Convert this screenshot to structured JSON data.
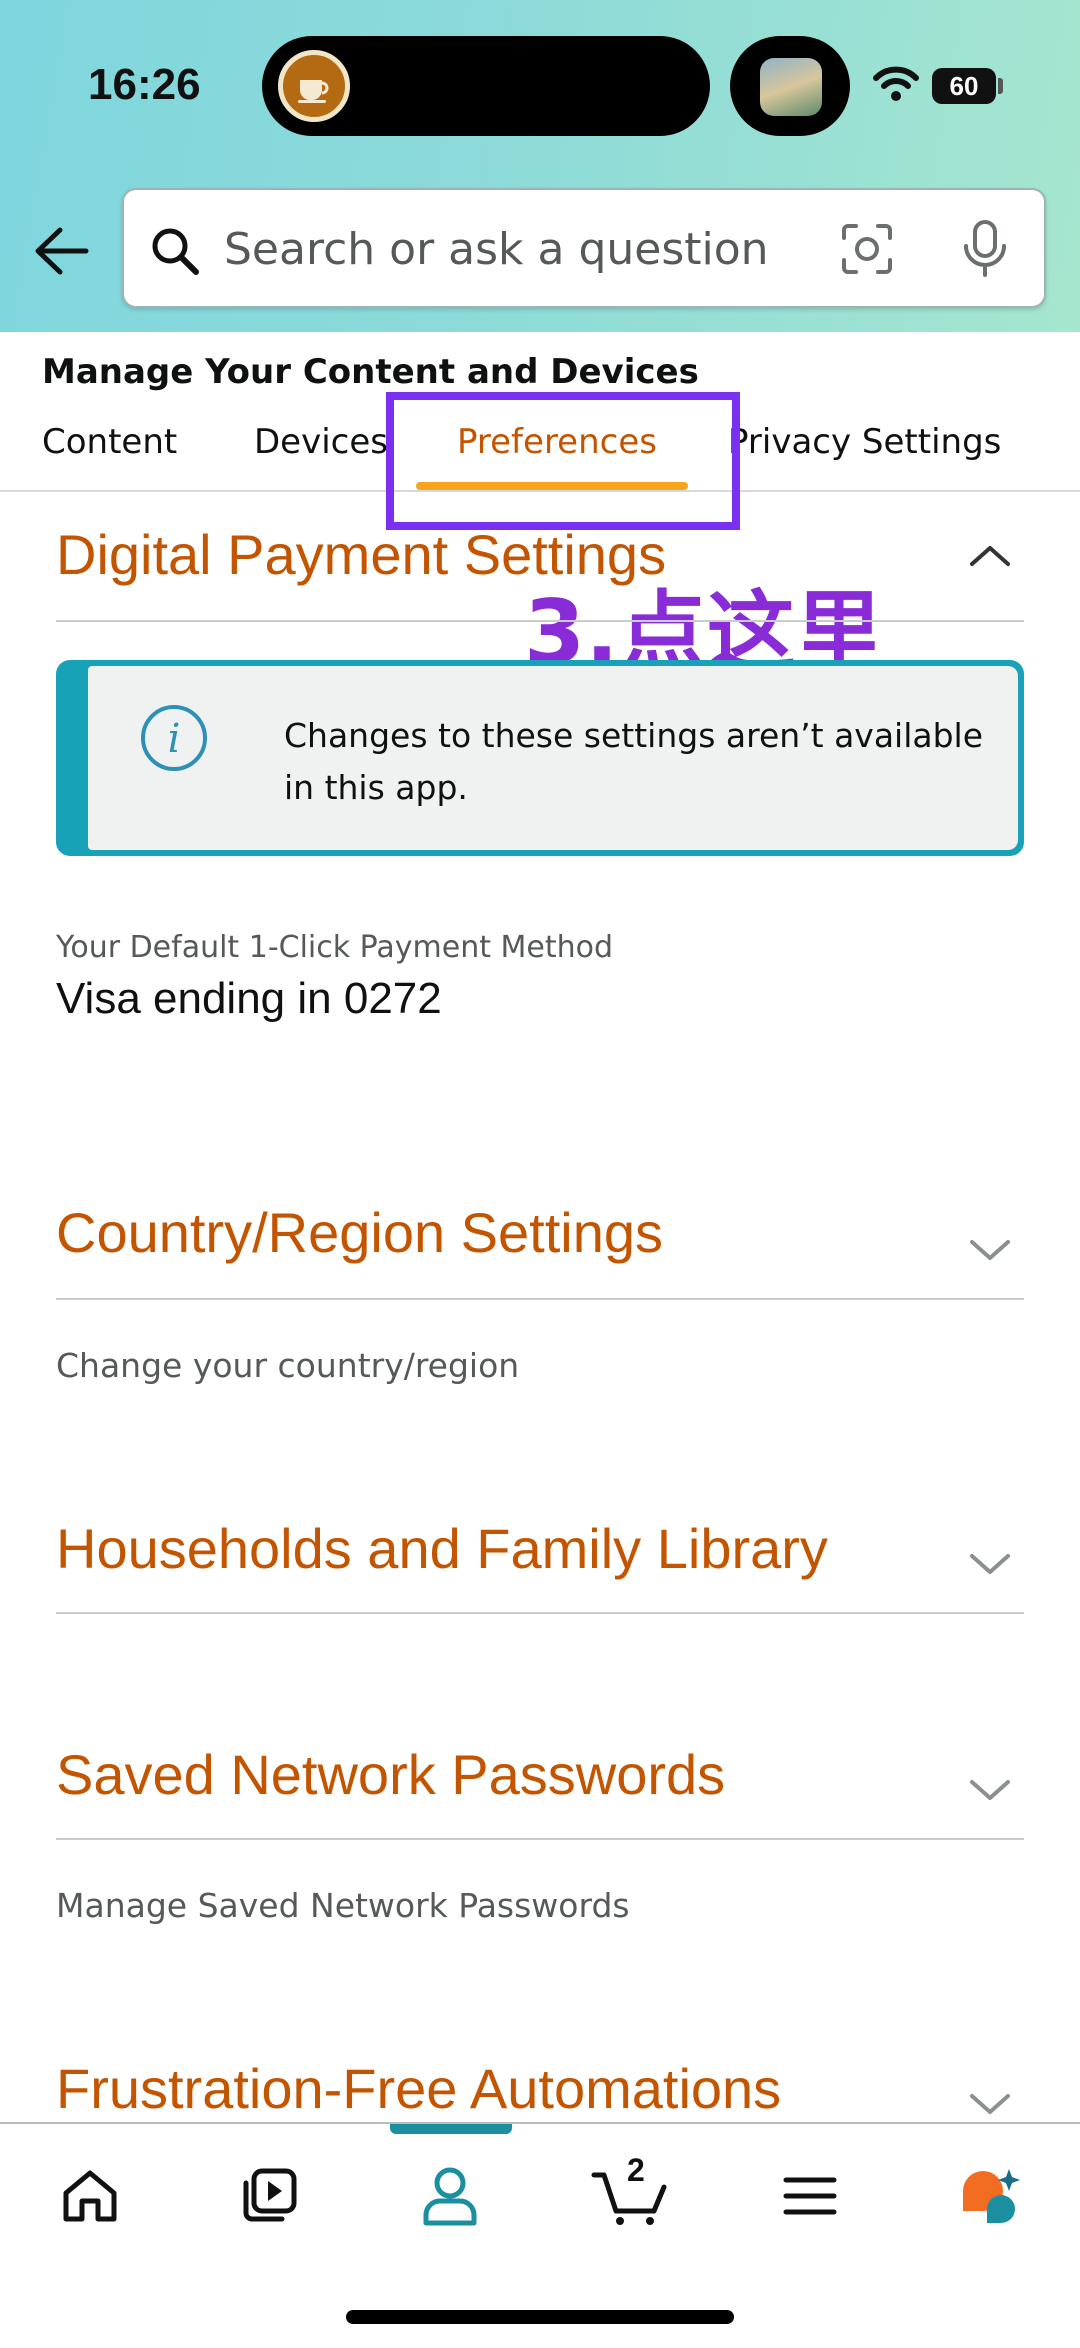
{
  "status_bar": {
    "time": "16:26",
    "battery": "60"
  },
  "search": {
    "placeholder": "Search or ask a question"
  },
  "page": {
    "title": "Manage Your Content and Devices",
    "tabs": [
      {
        "label": "Content",
        "active": false
      },
      {
        "label": "Devices",
        "active": false
      },
      {
        "label": "Preferences",
        "active": true
      },
      {
        "label": "Privacy Settings",
        "active": false
      }
    ]
  },
  "annotation": {
    "text": "3.点这里",
    "color": "#8a2bd8",
    "box_color": "#7b2ff0"
  },
  "sections": {
    "digital_payment": {
      "title": "Digital Payment Settings",
      "expanded": true,
      "alert_text": "Changes to these settings aren’t available in this app.",
      "payment_label": "Your Default 1-Click Payment Method",
      "payment_value": "Visa ending in 0272"
    },
    "country_region": {
      "title": "Country/Region Settings",
      "subtitle": "Change your country/region"
    },
    "households": {
      "title": "Households and Family Library"
    },
    "saved_passwords": {
      "title": "Saved Network Passwords",
      "subtitle": "Manage Saved Network Passwords"
    },
    "frustration_free": {
      "title": "Frustration-Free Automations"
    }
  },
  "bottom_nav": {
    "items": [
      {
        "icon": "home-icon"
      },
      {
        "icon": "video-icon"
      },
      {
        "icon": "account-icon",
        "active": true
      },
      {
        "icon": "cart-icon"
      },
      {
        "icon": "menu-icon"
      },
      {
        "icon": "rufus-assistant-icon"
      }
    ],
    "cart_count": "2"
  },
  "colors": {
    "accent_orange": "#c45500",
    "tab_underline": "#f7a51c",
    "teal": "#1b8ea0"
  }
}
